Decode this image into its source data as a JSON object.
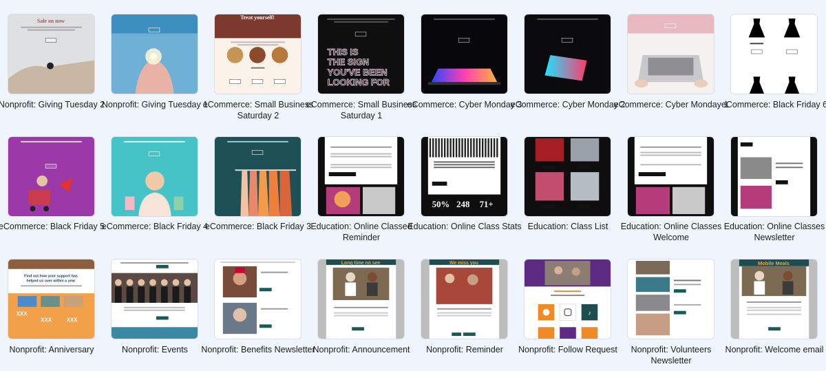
{
  "templates": [
    {
      "label": "Nonprofit: Giving Tuesday 2",
      "theme": "giving2"
    },
    {
      "label": "Nonprofit: Giving Tuesday 1",
      "theme": "giving1"
    },
    {
      "label": "eCommerce: Small Business Saturday 2",
      "theme": "sbs2"
    },
    {
      "label": "eCommerce: Small Business Saturday 1",
      "theme": "sbs1"
    },
    {
      "label": "eCommerce: Cyber Monday 3",
      "theme": "cyber3"
    },
    {
      "label": "eCommerce: Cyber Monday 2",
      "theme": "cyber2"
    },
    {
      "label": "eCommerce: Cyber Monday 1",
      "theme": "cyber1"
    },
    {
      "label": "eCommerce: Black Friday 6",
      "theme": "bf6"
    },
    {
      "label": "eCommerce: Black Friday 5",
      "theme": "bf5"
    },
    {
      "label": "eCommerce: Black Friday 4",
      "theme": "bf4"
    },
    {
      "label": "eCommerce: Black Friday 3",
      "theme": "bf3"
    },
    {
      "label": "Education: Online Classed Reminder",
      "theme": "edu1"
    },
    {
      "label": "Education: Online Class Stats",
      "theme": "edu2"
    },
    {
      "label": "Education: Class List",
      "theme": "edu3"
    },
    {
      "label": "Education: Online Classes Welcome",
      "theme": "edu4"
    },
    {
      "label": "Education: Online Classes Newsletter",
      "theme": "edu5"
    },
    {
      "label": "Nonprofit: Anniversary",
      "theme": "np1"
    },
    {
      "label": "Nonprofit: Events",
      "theme": "np2"
    },
    {
      "label": "Nonprofit: Benefits Newsletter",
      "theme": "np3"
    },
    {
      "label": "Nonprofit: Announcement",
      "theme": "np4"
    },
    {
      "label": "Nonprofit: Reminder",
      "theme": "np5"
    },
    {
      "label": "Nonprofit: Follow Request",
      "theme": "np6"
    },
    {
      "label": "Nonprofit: Volunteers Newsletter",
      "theme": "np7"
    },
    {
      "label": "Nonprofit: Welcome email",
      "theme": "np8"
    }
  ],
  "thumb_text": {
    "giving2": "Sale on now",
    "sbs2": "Treat yourself!",
    "sbs1": "THIS IS THE SIGN YOU'VE BEEN LOOKING FOR",
    "edu2_stats": [
      "50%",
      "248",
      "71+"
    ],
    "np1_title": "Find out how your support has helped us over within a year",
    "np1_xxx": "XXX",
    "np4_title": "Long time no see",
    "np5_title": "We miss you",
    "np8_title": "Mobile Meals"
  }
}
